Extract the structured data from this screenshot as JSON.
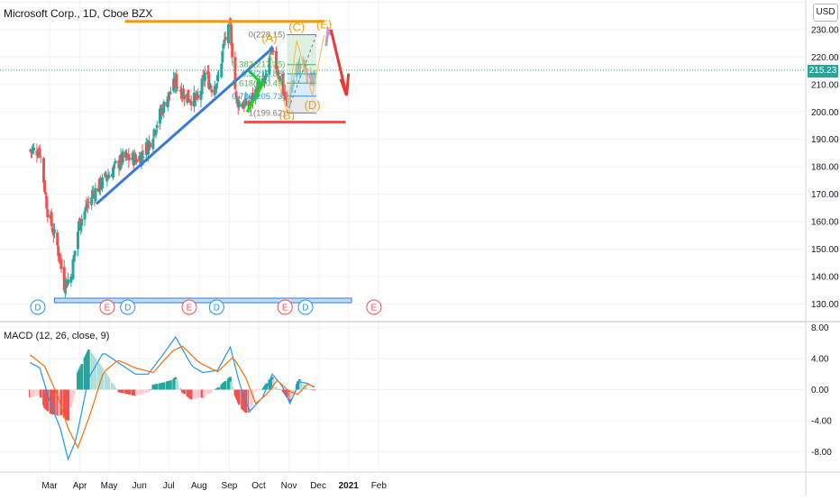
{
  "header": {
    "title": "Microsoft Corp., 1D, Cboe BZX",
    "currency": "USD",
    "last_price": "215.23"
  },
  "macd": {
    "title": "MACD (12, 26, close, 9)"
  },
  "colors": {
    "up": "#26a69a",
    "down": "#ef5350",
    "macd_line": "#2196f3",
    "signal_line": "#ff6d00",
    "resistance": "#ff9800",
    "support": "#ef5350",
    "trendline": "#3c78d8",
    "triangle": "#00e600",
    "base_box": "#3c78d8",
    "arrow": "#e53935",
    "path_arrow": "#c39bd3",
    "grid": "#f0f3fa",
    "axis_text": "#131722"
  },
  "chart_data": [
    {
      "type": "candlestick",
      "title": "Microsoft Corp., 1D, Cboe BZX",
      "x_tick_labels": [
        "Mar",
        "Apr",
        "May",
        "Jun",
        "Jul",
        "Aug",
        "Sep",
        "Oct",
        "Nov",
        "Dec",
        "2021",
        "Feb"
      ],
      "y_tick_labels": [
        "130.00",
        "140.00",
        "150.00",
        "160.00",
        "170.00",
        "180.00",
        "190.00",
        "200.00",
        "210.00",
        "220.00",
        "230.00",
        "240.00"
      ],
      "ylim": [
        127,
        242
      ],
      "last_price": 215.23,
      "anchors": [
        {
          "date": "2020-02-10",
          "close": 186
        },
        {
          "date": "2020-02-20",
          "close": 186
        },
        {
          "date": "2020-02-28",
          "close": 164
        },
        {
          "date": "2020-03-09",
          "close": 151
        },
        {
          "date": "2020-03-16",
          "close": 137
        },
        {
          "date": "2020-03-23",
          "close": 140
        },
        {
          "date": "2020-03-31",
          "close": 159
        },
        {
          "date": "2020-04-14",
          "close": 170
        },
        {
          "date": "2020-04-30",
          "close": 177
        },
        {
          "date": "2020-05-15",
          "close": 183
        },
        {
          "date": "2020-05-31",
          "close": 183
        },
        {
          "date": "2020-06-10",
          "close": 188
        },
        {
          "date": "2020-06-23",
          "close": 200
        },
        {
          "date": "2020-07-08",
          "close": 211
        },
        {
          "date": "2020-07-15",
          "close": 207
        },
        {
          "date": "2020-07-24",
          "close": 205
        },
        {
          "date": "2020-07-31",
          "close": 204
        },
        {
          "date": "2020-08-07",
          "close": 214
        },
        {
          "date": "2020-08-14",
          "close": 209
        },
        {
          "date": "2020-08-21",
          "close": 212
        },
        {
          "date": "2020-08-27",
          "close": 226
        },
        {
          "date": "2020-09-02",
          "close": 231
        },
        {
          "date": "2020-09-08",
          "close": 204
        },
        {
          "date": "2020-09-21",
          "close": 202
        },
        {
          "date": "2020-09-30",
          "close": 209
        },
        {
          "date": "2020-10-08",
          "close": 211
        },
        {
          "date": "2020-10-13",
          "close": 222
        },
        {
          "date": "2020-10-21",
          "close": 215
        },
        {
          "date": "2020-10-30",
          "close": 202
        },
        {
          "date": "2020-11-09",
          "close": 216
        },
        {
          "date": "2020-11-16",
          "close": 217
        },
        {
          "date": "2020-11-23",
          "close": 210
        },
        {
          "date": "2020-11-27",
          "close": 215.23
        }
      ],
      "macd": {
        "title": "MACD (12, 26, close, 9)",
        "y_tick_labels": [
          "8.00",
          "4.00",
          "0.00",
          "-4.00",
          "-8.00"
        ],
        "ylim": [
          -10,
          8.5
        ],
        "macd_points": [
          {
            "date": "2020-02-10",
            "value": 3.5
          },
          {
            "date": "2020-02-20",
            "value": 2.8
          },
          {
            "date": "2020-03-01",
            "value": -1.5
          },
          {
            "date": "2020-03-12",
            "value": -5.0
          },
          {
            "date": "2020-03-20",
            "value": -9.0
          },
          {
            "date": "2020-03-28",
            "value": -6.5
          },
          {
            "date": "2020-04-10",
            "value": 1.5
          },
          {
            "date": "2020-04-25",
            "value": 4.8
          },
          {
            "date": "2020-05-10",
            "value": 3.5
          },
          {
            "date": "2020-05-28",
            "value": 2.0
          },
          {
            "date": "2020-06-10",
            "value": 2.0
          },
          {
            "date": "2020-06-25",
            "value": 4.5
          },
          {
            "date": "2020-07-08",
            "value": 6.8
          },
          {
            "date": "2020-07-25",
            "value": 3.0
          },
          {
            "date": "2020-08-05",
            "value": 2.2
          },
          {
            "date": "2020-08-20",
            "value": 2.5
          },
          {
            "date": "2020-09-02",
            "value": 5.5
          },
          {
            "date": "2020-09-12",
            "value": 0.5
          },
          {
            "date": "2020-09-22",
            "value": -2.8
          },
          {
            "date": "2020-10-05",
            "value": -1.0
          },
          {
            "date": "2020-10-15",
            "value": 2.0
          },
          {
            "date": "2020-10-25",
            "value": 0.5
          },
          {
            "date": "2020-11-02",
            "value": -1.8
          },
          {
            "date": "2020-11-12",
            "value": 1.0
          },
          {
            "date": "2020-11-20",
            "value": 0.8
          },
          {
            "date": "2020-11-27",
            "value": 0.3
          }
        ],
        "signal_points": [
          {
            "date": "2020-02-10",
            "value": 4.5
          },
          {
            "date": "2020-02-25",
            "value": 3.0
          },
          {
            "date": "2020-03-10",
            "value": -1.0
          },
          {
            "date": "2020-03-20",
            "value": -5.0
          },
          {
            "date": "2020-03-30",
            "value": -7.5
          },
          {
            "date": "2020-04-12",
            "value": -3.0
          },
          {
            "date": "2020-04-25",
            "value": 2.2
          },
          {
            "date": "2020-05-10",
            "value": 3.8
          },
          {
            "date": "2020-05-28",
            "value": 2.8
          },
          {
            "date": "2020-06-15",
            "value": 2.2
          },
          {
            "date": "2020-07-05",
            "value": 5.0
          },
          {
            "date": "2020-07-15",
            "value": 5.6
          },
          {
            "date": "2020-08-01",
            "value": 3.5
          },
          {
            "date": "2020-08-20",
            "value": 2.3
          },
          {
            "date": "2020-09-05",
            "value": 4.2
          },
          {
            "date": "2020-09-18",
            "value": 1.5
          },
          {
            "date": "2020-09-28",
            "value": -1.8
          },
          {
            "date": "2020-10-10",
            "value": -0.5
          },
          {
            "date": "2020-10-20",
            "value": 1.2
          },
          {
            "date": "2020-11-01",
            "value": -0.2
          },
          {
            "date": "2020-11-10",
            "value": -0.6
          },
          {
            "date": "2020-11-20",
            "value": 0.7
          },
          {
            "date": "2020-11-27",
            "value": 0.4
          }
        ]
      }
    }
  ],
  "annotations": {
    "fib_levels": [
      {
        "level": "0(228.15)",
        "price": 228.15
      },
      {
        "level": "0.382(217.25)",
        "price": 217.25
      },
      {
        "level": "0.5(213.88)",
        "price": 213.88
      },
      {
        "level": "0.618(210.49)",
        "price": 210.49
      },
      {
        "level": "0.786(205.73)",
        "price": 205.73
      },
      {
        "level": "1(199.62)",
        "price": 199.62
      }
    ],
    "wave_labels": [
      {
        "text": "(A)",
        "date": "2020-10-12",
        "price": 225.5
      },
      {
        "text": "(B)",
        "date": "2020-10-30",
        "price": 197.3
      },
      {
        "text": "(C)",
        "date": "2020-11-09",
        "price": 229.5
      },
      {
        "text": "(D)",
        "date": "2020-11-25",
        "price": 201.0
      },
      {
        "text": "(E)",
        "date": "2020-12-07",
        "price": 230.5
      }
    ],
    "event_markers": [
      {
        "text": "D",
        "date": "2020-02-18"
      },
      {
        "text": "E",
        "date": "2020-04-29"
      },
      {
        "text": "D",
        "date": "2020-05-20"
      },
      {
        "text": "E",
        "date": "2020-07-22"
      },
      {
        "text": "D",
        "date": "2020-08-19"
      },
      {
        "text": "E",
        "date": "2020-10-28"
      },
      {
        "text": "D",
        "date": "2020-11-18"
      },
      {
        "text": "E",
        "date": "2021-01-27"
      }
    ]
  }
}
